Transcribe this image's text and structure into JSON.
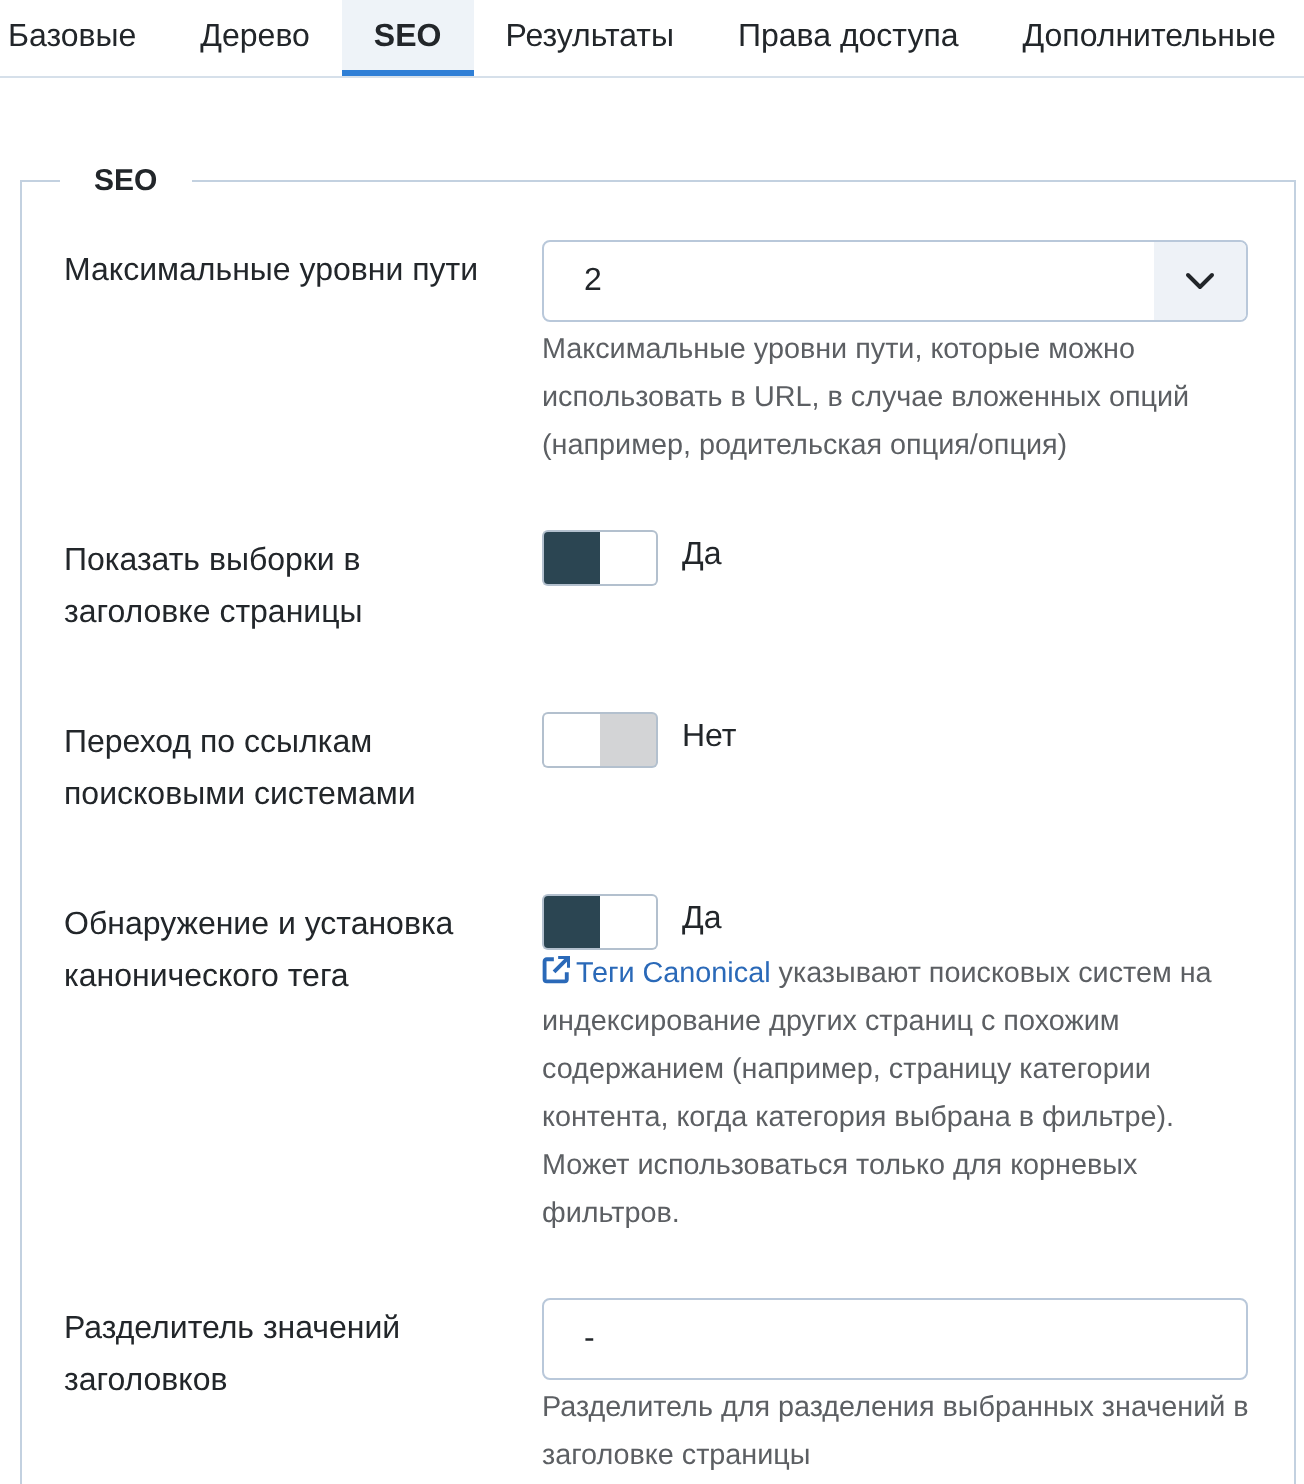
{
  "tabs": [
    {
      "label": "Базовые",
      "selected": false
    },
    {
      "label": "Дерево",
      "selected": false
    },
    {
      "label": "SEO",
      "selected": true
    },
    {
      "label": "Результаты",
      "selected": false
    },
    {
      "label": "Права доступа",
      "selected": false
    },
    {
      "label": "Дополнительные",
      "selected": false
    }
  ],
  "fieldset": {
    "legend": "SEO",
    "fields": [
      {
        "kind": "select",
        "label": "Максимальные уровни пути",
        "value": "2",
        "help": "Максимальные уровни пути, которые можно использовать в URL, в случае вложенных опций (например, родительская опция/опция)"
      },
      {
        "kind": "toggle",
        "label": "Показать выборки в заголовке страницы",
        "on": true,
        "state_text": "Да"
      },
      {
        "kind": "toggle",
        "label": "Переход по ссылкам поисковыми системами",
        "on": false,
        "state_text": "Нет"
      },
      {
        "kind": "toggle",
        "label": "Обнаружение и установка канонического тега",
        "on": true,
        "state_text": "Да",
        "help_link": "Теги Canonical",
        "help": "указывают поисковых систем на индексирование других страниц с похожим содержанием (например, страницу категории контента, когда категория выбрана в фильтре). Может использоваться только для корневых фильтров."
      },
      {
        "kind": "text",
        "label": "Разделитель значений заголовков",
        "value": "-",
        "help": "Разделитель для разделения выбранных значений в заголовке страницы"
      }
    ]
  }
}
